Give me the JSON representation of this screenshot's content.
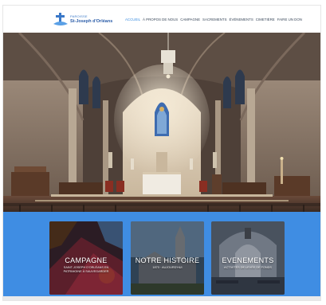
{
  "logo": {
    "small_text": "Paroisse",
    "name": "St-Joseph d'Orléans"
  },
  "nav": {
    "items": [
      {
        "label": "ACCUEIL",
        "active": true
      },
      {
        "label": "À PROPOS DE NOUS",
        "active": false
      },
      {
        "label": "CAMPAGNE",
        "active": false
      },
      {
        "label": "SACREMENTS",
        "active": false
      },
      {
        "label": "ÉVÉNEMENTS",
        "active": false
      },
      {
        "label": "CIMETIÈRE",
        "active": false
      },
      {
        "label": "FAIRE UN DON",
        "active": false
      }
    ]
  },
  "cards": [
    {
      "title": "CAMPAGNE",
      "subtitle": "SAINT-JOSEPH D'ORLÉANS EN PATRIMOINE À SAUVEGARDER"
    },
    {
      "title": "NOTRE HISTOIRE",
      "subtitle": "1870 · aujourd'hui"
    },
    {
      "title": "EVENEMENTS",
      "subtitle": "Activités de levée de fonds"
    }
  ],
  "colors": {
    "accent": "#3f8de3",
    "nav_active": "#3a8ce0",
    "nav_text": "#3c4a5c",
    "logo_blue": "#2a5ca8"
  }
}
